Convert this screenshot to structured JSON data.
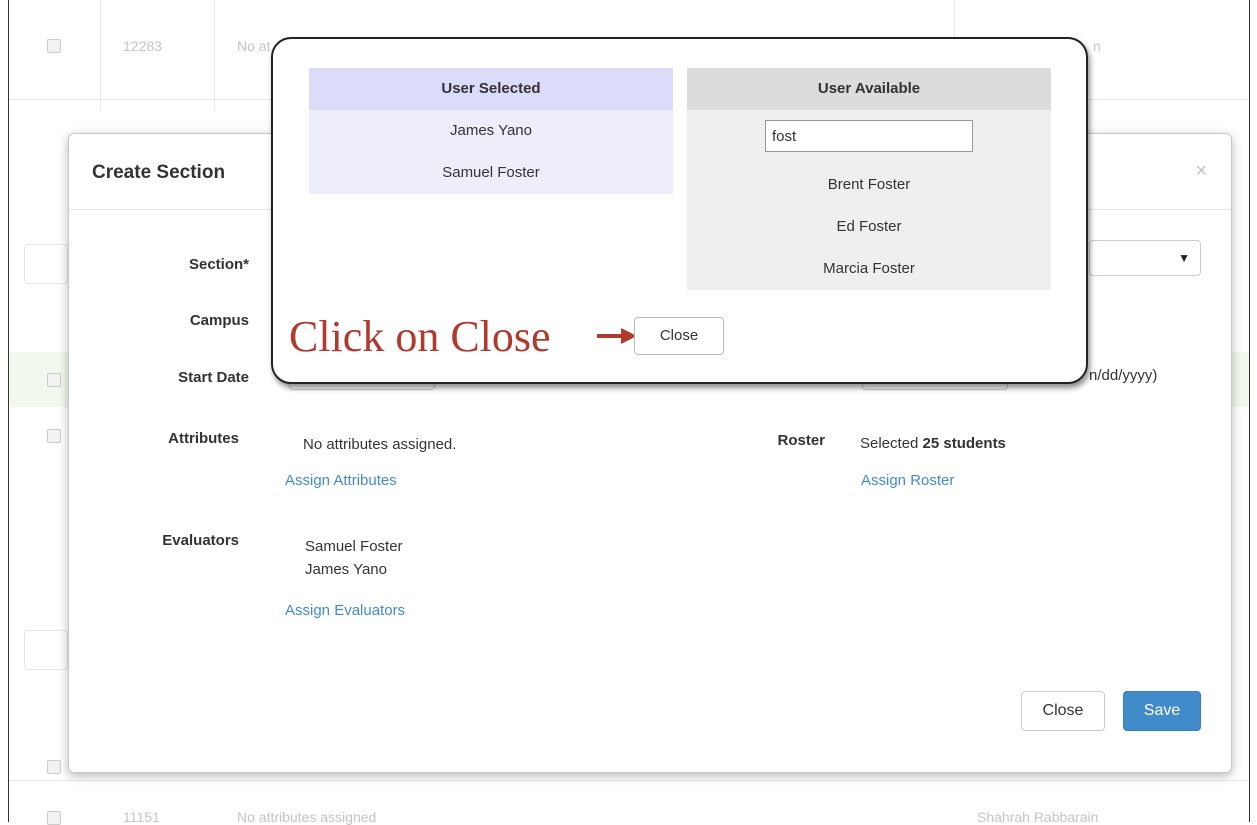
{
  "background": {
    "rows": [
      {
        "id": "12283",
        "text": "No at",
        "right": "n"
      },
      {
        "id": "11151",
        "text": "No attributes assigned",
        "right": "Shahrah Rabbarain"
      }
    ],
    "date_hint": "n/dd/yyyy)"
  },
  "modal": {
    "title": "Create Section",
    "close_x": "×",
    "select_caret": "▼",
    "labels": {
      "section": "Section*",
      "campus": "Campus",
      "start_date": "Start Date",
      "attributes": "Attributes",
      "evaluators": "Evaluators",
      "roster": "Roster"
    },
    "attributes_text": "No attributes assigned.",
    "assign_attributes": "Assign Attributes",
    "roster_prefix": "Selected ",
    "roster_count": "25 students",
    "assign_roster": "Assign Roster",
    "evaluators_list": [
      "Samuel Foster",
      "James Yano"
    ],
    "assign_evaluators": "Assign Evaluators",
    "close_label": "Close",
    "save_label": "Save"
  },
  "popup": {
    "selected_header": "User Selected",
    "selected": [
      "James Yano",
      "Samuel Foster"
    ],
    "available_header": "User Available",
    "search_value": "fost",
    "available": [
      "Brent Foster",
      "Ed Foster",
      "Marcia Foster"
    ],
    "callout": "Click on Close",
    "close_label": "Close",
    "colors": {
      "callout": "#b03a2e",
      "selected_bg": "#eeeefa",
      "selected_head": "#dcdcfa",
      "available_bg": "#efefef"
    }
  }
}
